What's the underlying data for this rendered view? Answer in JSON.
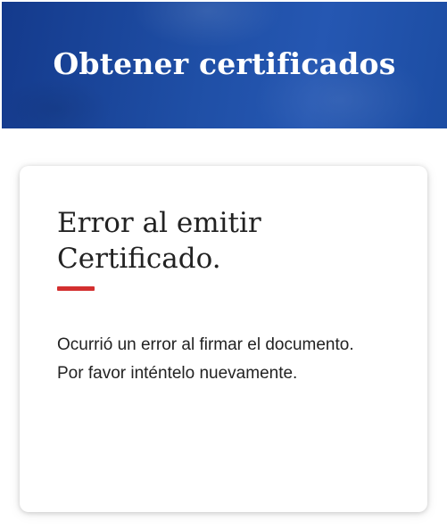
{
  "header": {
    "title": "Obtener certificados"
  },
  "card": {
    "title": "Error al emitir Certificado.",
    "message": "Ocurrió un error al firmar el documento. Por favor inténtelo nuevamente."
  },
  "colors": {
    "banner_primary": "#1f4fa6",
    "accent": "#d32f2f",
    "text": "#222222"
  }
}
